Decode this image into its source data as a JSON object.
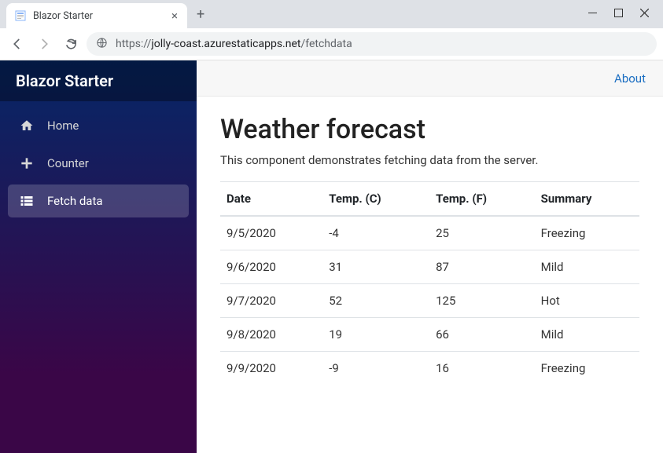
{
  "browser": {
    "tab_title": "Blazor Starter",
    "url_scheme": "https://",
    "url_host": "jolly-coast.azurestaticapps.net",
    "url_path": "/fetchdata"
  },
  "sidebar": {
    "brand": "Blazor Starter",
    "items": [
      {
        "label": "Home",
        "icon": "home-icon",
        "active": false
      },
      {
        "label": "Counter",
        "icon": "plus-icon",
        "active": false
      },
      {
        "label": "Fetch data",
        "icon": "list-icon",
        "active": true
      }
    ]
  },
  "header": {
    "about": "About"
  },
  "page": {
    "title": "Weather forecast",
    "subtitle": "This component demonstrates fetching data from the server."
  },
  "table": {
    "columns": [
      "Date",
      "Temp. (C)",
      "Temp. (F)",
      "Summary"
    ],
    "rows": [
      {
        "date": "9/5/2020",
        "c": "-4",
        "f": "25",
        "summary": "Freezing"
      },
      {
        "date": "9/6/2020",
        "c": "31",
        "f": "87",
        "summary": "Mild"
      },
      {
        "date": "9/7/2020",
        "c": "52",
        "f": "125",
        "summary": "Hot"
      },
      {
        "date": "9/8/2020",
        "c": "19",
        "f": "66",
        "summary": "Mild"
      },
      {
        "date": "9/9/2020",
        "c": "-9",
        "f": "16",
        "summary": "Freezing"
      }
    ]
  }
}
